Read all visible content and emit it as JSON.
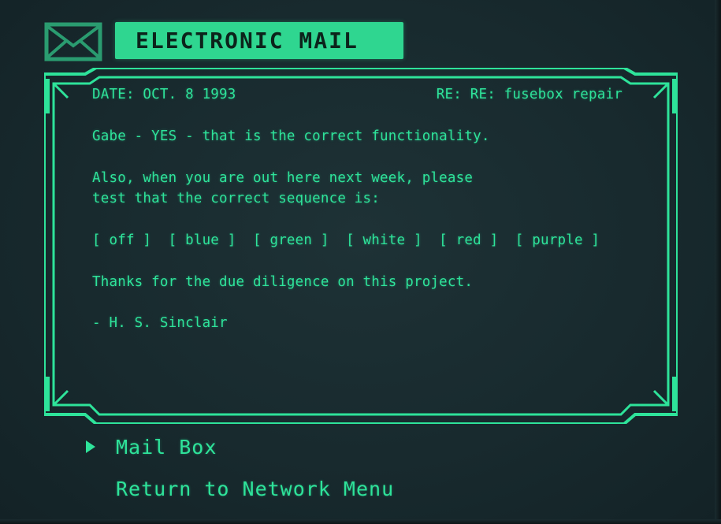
{
  "header": {
    "title": "ELECTRONIC MAIL",
    "icon": "envelope-icon"
  },
  "email": {
    "date": "DATE: OCT. 8 1993",
    "subject": "RE: RE: fusebox repair",
    "line1": "Gabe - YES - that is the correct functionality.",
    "line2": "Also, when you are out here next week, please",
    "line3": "test that the correct sequence is:",
    "sequence": "[ off ]  [ blue ]  [ green ]  [ white ]  [ red ]  [ purple ]",
    "thanks": "Thanks for the due diligence on this project.",
    "signature": "- H. S. Sinclair"
  },
  "menu": {
    "items": [
      {
        "label": "Mail Box",
        "selected": true
      },
      {
        "label": "Return to Network Menu",
        "selected": false
      }
    ],
    "cursor_icon": "triangle-right-icon"
  },
  "colors": {
    "accent": "#2ee39a",
    "background": "#1b2d31",
    "title_fill": "#2fd690"
  }
}
